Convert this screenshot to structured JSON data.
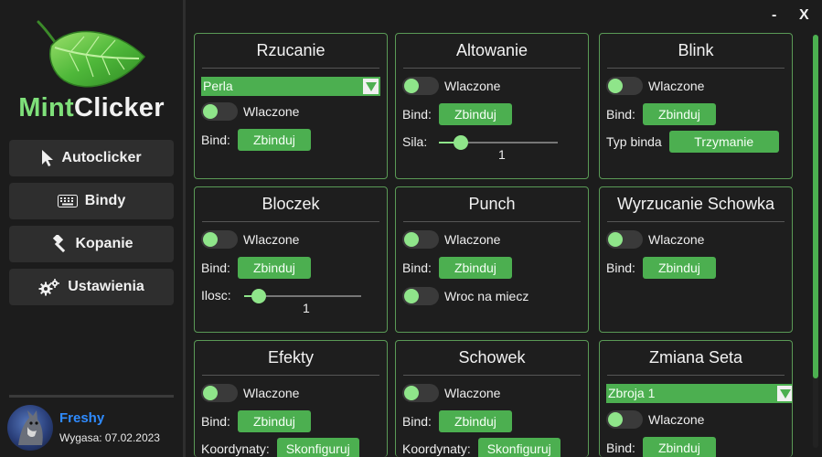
{
  "app": {
    "logo_part1": "Mint",
    "logo_part2": "Clicker",
    "minimize_label": "-",
    "close_label": "X",
    "accent_color": "#4caf50"
  },
  "sidebar": {
    "items": [
      {
        "label": "Autoclicker",
        "icon": "cursor-icon"
      },
      {
        "label": "Bindy",
        "icon": "keyboard-icon"
      },
      {
        "label": "Kopanie",
        "icon": "hammer-icon"
      },
      {
        "label": "Ustawienia",
        "icon": "gears-icon"
      }
    ],
    "user": {
      "name": "Freshy",
      "expiry": "Wygasa: 07.02.2023"
    }
  },
  "cards": {
    "rzucanie": {
      "title": "Rzucanie",
      "select_value": "Perla",
      "toggle_label": "Wlaczone",
      "bind_label": "Bind:",
      "bind_button": "Zbinduj"
    },
    "altowanie": {
      "title": "Altowanie",
      "toggle_label": "Wlaczone",
      "bind_label": "Bind:",
      "bind_button": "Zbinduj",
      "slider_label": "Sila:",
      "slider_value": "1"
    },
    "blink": {
      "title": "Blink",
      "toggle_label": "Wlaczone",
      "bind_label": "Bind:",
      "bind_button": "Zbinduj",
      "mode_label": "Typ binda",
      "mode_button": "Trzymanie"
    },
    "bloczek": {
      "title": "Bloczek",
      "toggle_label": "Wlaczone",
      "bind_label": "Bind:",
      "bind_button": "Zbinduj",
      "slider_label": "Ilosc:",
      "slider_value": "1"
    },
    "punch": {
      "title": "Punch",
      "toggle_label": "Wlaczone",
      "bind_label": "Bind:",
      "bind_button": "Zbinduj",
      "toggle2_label": "Wroc na miecz"
    },
    "wyrzucanie": {
      "title": "Wyrzucanie Schowka",
      "toggle_label": "Wlaczone",
      "bind_label": "Bind:",
      "bind_button": "Zbinduj"
    },
    "efekty": {
      "title": "Efekty",
      "toggle_label": "Wlaczone",
      "bind_label": "Bind:",
      "bind_button": "Zbinduj",
      "coords_label": "Koordynaty:",
      "coords_button": "Skonfiguruj"
    },
    "schowek": {
      "title": "Schowek",
      "toggle_label": "Wlaczone",
      "bind_label": "Bind:",
      "bind_button": "Zbinduj",
      "coords_label": "Koordynaty:",
      "coords_button": "Skonfiguruj"
    },
    "zmiana_seta": {
      "title": "Zmiana Seta",
      "select_value": "Zbroja 1",
      "toggle_label": "Wlaczone",
      "bind_label": "Bind:",
      "bind_button": "Zbinduj"
    }
  }
}
